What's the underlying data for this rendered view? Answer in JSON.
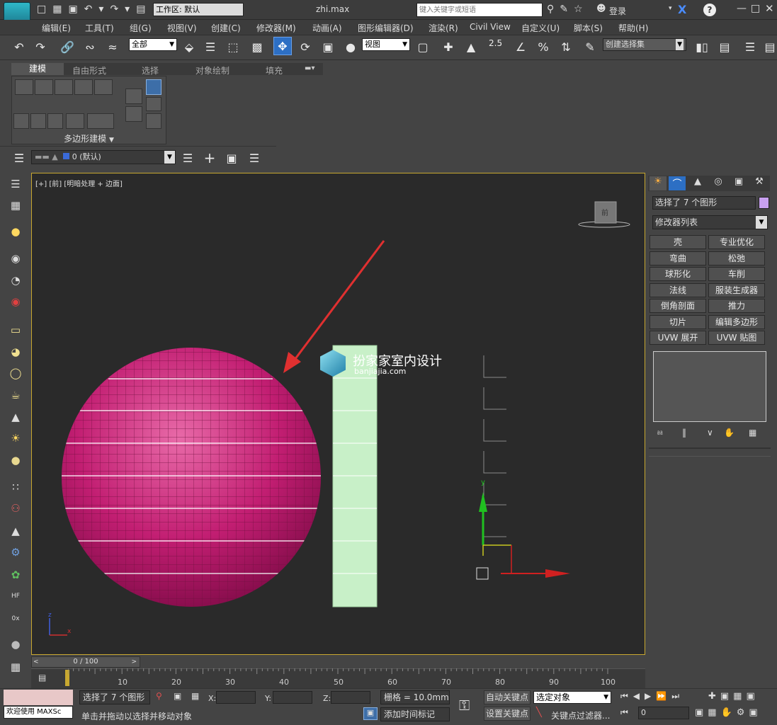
{
  "window": {
    "title": "zhi.max",
    "workspace_label": "工作区: 默认",
    "search_placeholder": "键入关键字或短语",
    "login": "登录"
  },
  "menu": [
    "编辑(E)",
    "工具(T)",
    "组(G)",
    "视图(V)",
    "创建(C)",
    "修改器(M)",
    "动画(A)",
    "图形编辑器(D)",
    "渲染(R)",
    "Civil View",
    "自定义(U)",
    "脚本(S)",
    "帮助(H)"
  ],
  "toolbar": {
    "filter_value": "全部",
    "coord_value": "视图",
    "selection_set_value": "创建选择集",
    "snap_value": "2.5"
  },
  "ribbon": {
    "tabs": [
      "建模",
      "自由形式",
      "选择",
      "对象绘制",
      "填充"
    ],
    "panel_label": "多边形建模"
  },
  "layer": {
    "value": "0 (默认)"
  },
  "viewport": {
    "label": "[+] [前] [明暗处理 + 边面]",
    "cube_label": "前"
  },
  "watermark": {
    "title": "扮家家室内设计",
    "url": "banjiajia.com"
  },
  "command_panel": {
    "selection_text": "选择了 7 个图形",
    "modifier_list": "修改器列表",
    "modifier_color": "#c8a0f0",
    "modifiers": [
      "壳",
      "专业优化",
      "弯曲",
      "松弛",
      "球形化",
      "车削",
      "法线",
      "服装生成器",
      "倒角剖面",
      "推力",
      "切片",
      "编辑多边形",
      "UVW 展开",
      "UVW 贴图"
    ]
  },
  "timeline": {
    "frame": "0 / 100",
    "ticks": [
      "10",
      "20",
      "30",
      "40",
      "50",
      "60",
      "70",
      "80",
      "90",
      "100"
    ]
  },
  "status": {
    "welcome": "欢迎使用 MAXSc",
    "selected": "选择了 7 个图形",
    "hint": "单击并拖动以选择并移动对象",
    "x_label": "X:",
    "y_label": "Y:",
    "z_label": "Z:",
    "grid": "栅格 = 10.0mm",
    "add_time_tag": "添加时间标记",
    "auto_key": "自动关键点",
    "set_key": "设置关键点",
    "selected_object": "选定对象",
    "key_filter": "关键点过滤器...",
    "frame_value": "0"
  },
  "axis": {
    "x": "x",
    "y": "y",
    "z": "z"
  }
}
